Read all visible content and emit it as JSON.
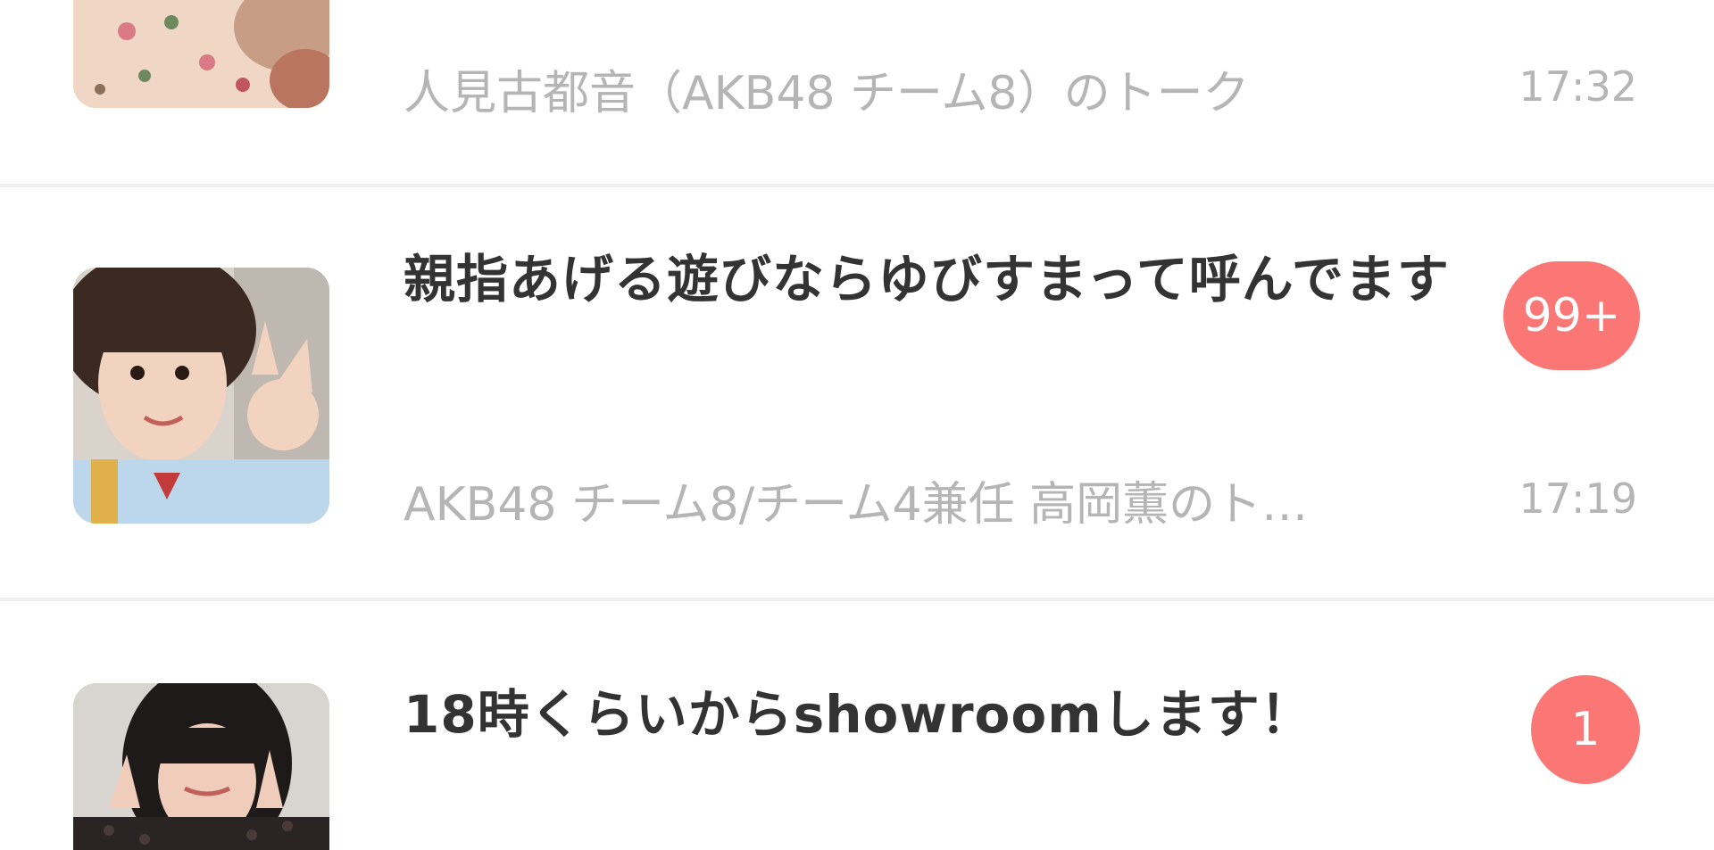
{
  "chats": [
    {
      "title": "",
      "preview": "人見古都音（AKB48 チーム8）のトーク",
      "time": "17:32",
      "badge": ""
    },
    {
      "title": "親指あげる遊びならゆびすまって呼んでます",
      "preview": "AKB48 チーム8/チーム4兼任 高岡薫のト…",
      "time": "17:19",
      "badge": "99+"
    },
    {
      "title": "18時くらいからshowroomします！",
      "preview": "",
      "time": "",
      "badge": "1"
    }
  ],
  "colors": {
    "badge": "#fa7775",
    "title": "#333333",
    "muted": "#b5b5b5",
    "divider": "#efefef"
  }
}
